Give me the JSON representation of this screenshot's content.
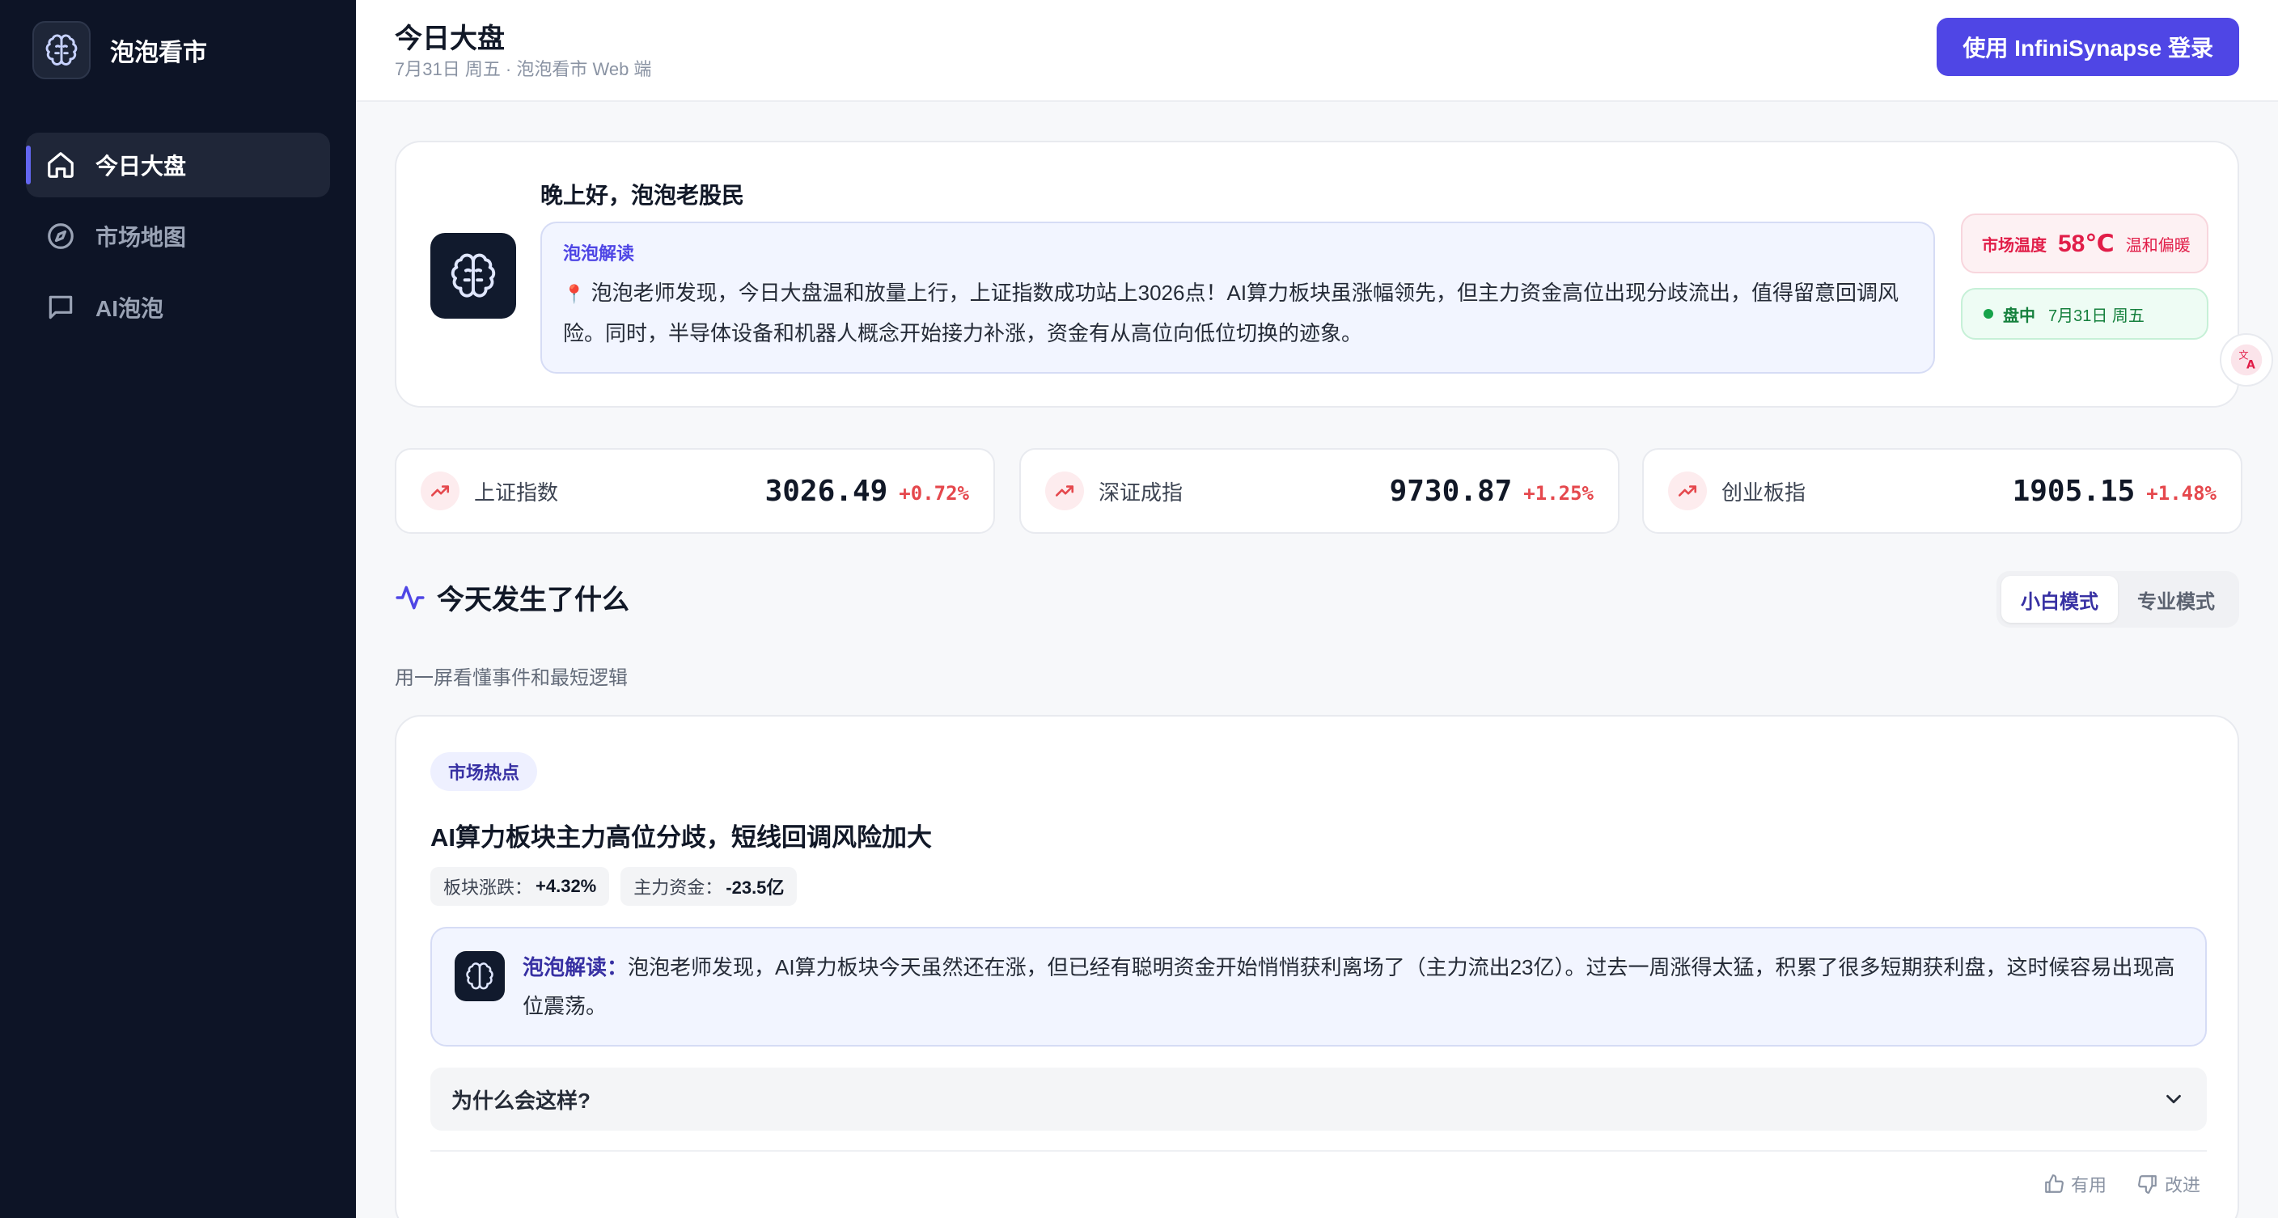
{
  "app": {
    "name": "泡泡看市"
  },
  "sidebar": {
    "items": [
      {
        "label": "今日大盘",
        "icon": "home-icon",
        "active": true
      },
      {
        "label": "市场地图",
        "icon": "compass-icon",
        "active": false
      },
      {
        "label": "AI泡泡",
        "icon": "chat-icon",
        "active": false
      }
    ]
  },
  "header": {
    "title": "今日大盘",
    "subtitle": "7月31日 周五 · 泡泡看市 Web 端",
    "login_label": "使用 InfiniSynapse 登录"
  },
  "greeting": {
    "title": "晚上好，泡泡老股民",
    "box_label": "泡泡解读",
    "box_text": "泡泡老师发现，今日大盘温和放量上行，上证指数成功站上3026点！AI算力板块虽涨幅领先，但主力资金高位出现分歧流出，值得留意回调风险。同时，半导体设备和机器人概念开始接力补涨，资金有从高位向低位切换的迹象。",
    "temp_label": "市场温度",
    "temp_value": "58℃",
    "temp_desc": "温和偏暖",
    "status_label": "盘中",
    "status_date": "7月31日 周五"
  },
  "indices": [
    {
      "name": "上证指数",
      "value": "3026.49",
      "change": "+0.72%"
    },
    {
      "name": "深证成指",
      "value": "9730.87",
      "change": "+1.25%"
    },
    {
      "name": "创业板指",
      "value": "1905.15",
      "change": "+1.48%"
    }
  ],
  "section": {
    "title": "今天发生了什么",
    "subtitle": "用一屏看懂事件和最短逻辑",
    "modes": [
      "小白模式",
      "专业模式"
    ]
  },
  "event": {
    "tag": "市场热点",
    "title": "AI算力板块主力高位分歧，短线回调风险加大",
    "metrics": [
      {
        "label": "板块涨跌：",
        "value": "+4.32%"
      },
      {
        "label": "主力资金：",
        "value": "-23.5亿"
      }
    ],
    "insight_label": "泡泡解读：",
    "insight_text": "泡泡老师发现，AI算力板块今天虽然还在涨，但已经有聪明资金开始悄悄获利离场了（主力流出23亿）。过去一周涨得太猛，积累了很多短期获利盘，这时候容易出现高位震荡。",
    "why_label": "为什么会这样?",
    "feedback": {
      "useful": "有用",
      "improve": "改进"
    }
  },
  "colors": {
    "accent": "#4f46e5",
    "sidebar_bg": "#0d1426",
    "up": "#e5484d",
    "positive_status": "#16a34a"
  }
}
